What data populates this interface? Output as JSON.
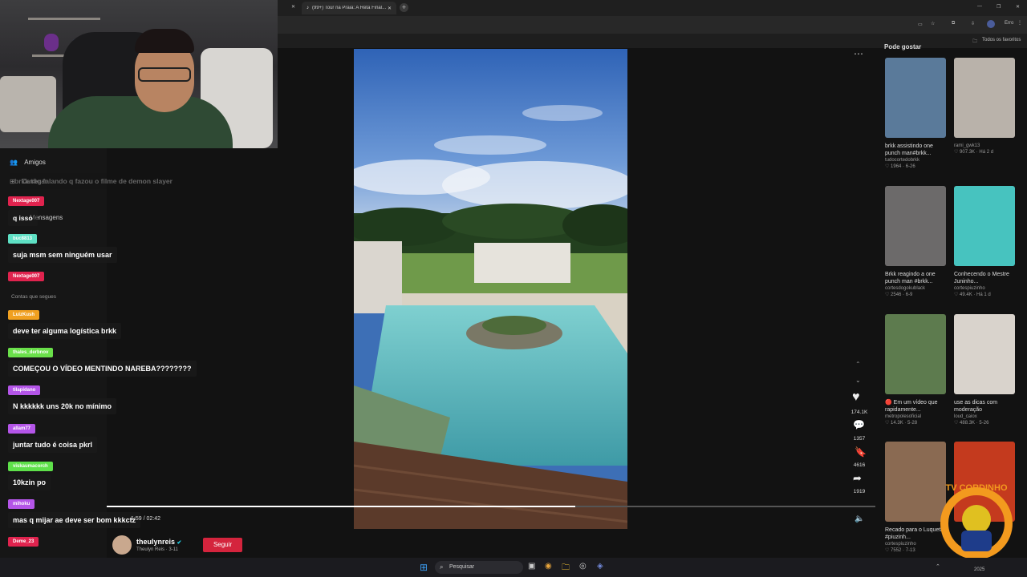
{
  "browser": {
    "tab_title": "(99+) Tour na Praia: A Reta Final...",
    "profile_label": "Erro",
    "bookmarks_label": "Todos os favoritos"
  },
  "sidebar": {
    "items": [
      {
        "icon": "users-icon",
        "label": "Amigos"
      },
      {
        "icon": "upload-icon",
        "label": "Carregar"
      },
      {
        "icon": "message-icon",
        "label": "Mensagens"
      }
    ],
    "section_label": "Contas que segues"
  },
  "chat": {
    "messages": [
      {
        "user": "",
        "text": "brkk tão falando q fazou o filme de demon slayer",
        "color": "#555555"
      },
      {
        "user": "Nextage007",
        "text": "q isso",
        "color": "#e0234e"
      },
      {
        "user": "buc8813",
        "text": "suja msm sem ninguém usar",
        "color": "#5ee0c4"
      },
      {
        "user": "Nextage007",
        "text": "",
        "color": "#e0234e"
      },
      {
        "user": "LuizKush",
        "text": "deve ter alguma logística brkk",
        "color": "#f0a020"
      },
      {
        "user": "thales_derbnov",
        "text": "COMEÇOU O VÍDEO MENTINDO NAREBA????????",
        "color": "#6ae04a"
      },
      {
        "user": "tilapidano",
        "text": "N kkkkkk uns 20k no mínimo",
        "color": "#b455e8"
      },
      {
        "user": "allam77",
        "text": "juntar tudo é coisa pkrl",
        "color": "#b455e8"
      },
      {
        "user": "viskaumacorch",
        "text": "10kzin po",
        "color": "#5ee04a"
      },
      {
        "user": "mihoku",
        "text": "mas q mijar ae deve ser bom kkkctz",
        "color": "#b455e8"
      },
      {
        "user": "Deme_23",
        "text": "",
        "color": "#e0234e"
      }
    ]
  },
  "player": {
    "time": "1:59 / 02:42",
    "progress": 0.61
  },
  "creator": {
    "handle": "theulynreis",
    "subtitle": "Theulyn Reis · 3-11",
    "follow_label": "Seguir"
  },
  "actions": {
    "likes": "174.1K",
    "comments": "1357",
    "saves": "4616",
    "shares": "1919"
  },
  "recommendations": {
    "heading": "Pode gostar",
    "items": [
      {
        "caption": "brkk assistindo one punch man#brkk...",
        "author": "tudocortedobrkk",
        "stats": "♡ 1964 · 6-26",
        "color": "#5a7a9a"
      },
      {
        "caption": "",
        "author": "rami_gwk13",
        "stats": "♡ 907.3K · Há 2 d",
        "color": "#b9b2aa"
      },
      {
        "caption": "Brkk reagindo a one punch man #brkk...",
        "author": "cortesdogokublack",
        "stats": "♡ 2546 · 6-9",
        "color": "#6c6a6a"
      },
      {
        "caption": "Conhecendo o Mestre Juninho...",
        "author": "cortespiuzinho",
        "stats": "♡ 49.4K · Há 1 d",
        "color": "#47c3bf"
      },
      {
        "caption": "🔴 Em um vídeo que rapidamente...",
        "author": "metropolesoficial",
        "stats": "♡ 14.3K · 5-28",
        "color": "#5d7b4e"
      },
      {
        "caption": "use as dicas com moderação",
        "author": "loud_caiox",
        "stats": "♡ 488.3K · 5-26",
        "color": "#d9d3cc"
      },
      {
        "caption": "Recado para o Luqueta #piuzinh...",
        "author": "cortespiuzinho",
        "stats": "♡ 7552 · 7-13",
        "color": "#8a6a52"
      },
      {
        "caption": "",
        "author": "",
        "stats": "",
        "color": "#c43a1e"
      }
    ]
  },
  "taskbar": {
    "search_label": "Pesquisar",
    "year": "2025"
  },
  "overlay": {
    "logo_text": "TV CORDINHO"
  }
}
